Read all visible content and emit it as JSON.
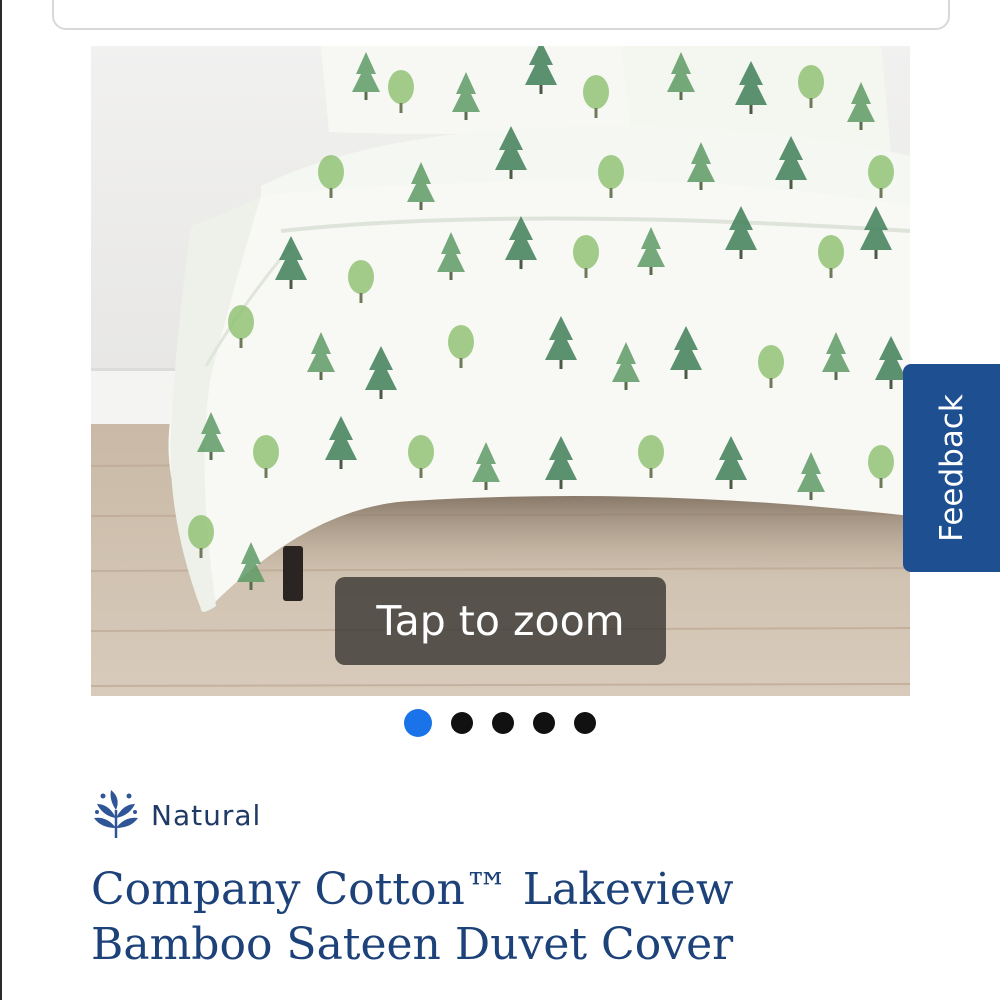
{
  "gallery": {
    "zoom_label": "Tap to zoom",
    "next_icon": "chevron-right-icon",
    "total_images": 5,
    "active_index": 0,
    "active_dot_color": "#1a73e8"
  },
  "feedback": {
    "label": "Feedback",
    "color": "#1d4f91"
  },
  "product": {
    "badge_icon": "natural-leaf-icon",
    "badge_label": "Natural",
    "title_line1": "Company Cotton™ Lakeview",
    "title_line2": "Bamboo Sateen Duvet Cover",
    "title_color": "#1d4279"
  }
}
